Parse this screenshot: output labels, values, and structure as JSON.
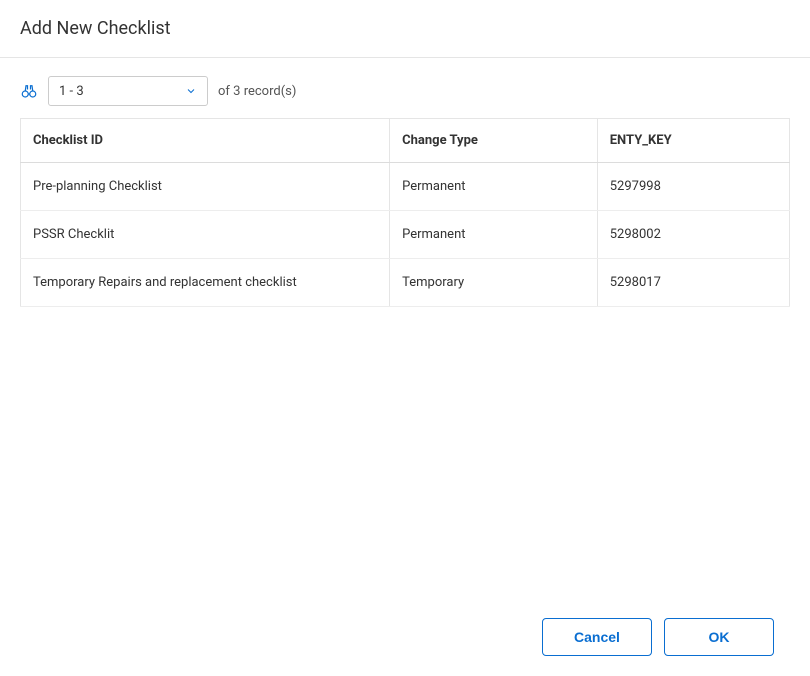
{
  "header": {
    "title": "Add New Checklist"
  },
  "toolbar": {
    "range_select_value": "1 - 3",
    "record_count_text": "of  3  record(s)"
  },
  "table": {
    "columns": {
      "checklist_id": "Checklist ID",
      "change_type": "Change Type",
      "enty_key": "ENTY_KEY"
    },
    "rows": [
      {
        "checklist_id": "Pre-planning Checklist",
        "change_type": "Permanent",
        "enty_key": "5297998"
      },
      {
        "checklist_id": "PSSR Checklit",
        "change_type": "Permanent",
        "enty_key": "5298002"
      },
      {
        "checklist_id": "Temporary Repairs and replacement checklist",
        "change_type": "Temporary",
        "enty_key": "5298017"
      }
    ]
  },
  "footer": {
    "cancel_label": "Cancel",
    "ok_label": "OK"
  }
}
